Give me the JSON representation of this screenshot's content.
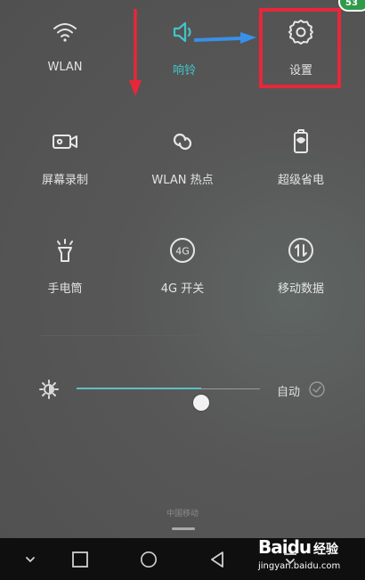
{
  "colors": {
    "accent": "#43c4c8",
    "highlight_box": "#e8263a",
    "arrow_red": "#e8263a",
    "arrow_blue": "#3a8fe8",
    "badge": "#2f9a4a"
  },
  "tiles": [
    {
      "label": "WLAN",
      "icon": "wifi-icon",
      "active": false
    },
    {
      "label": "响铃",
      "icon": "speaker-icon",
      "active": true
    },
    {
      "label": "设置",
      "icon": "gear-icon",
      "active": false
    },
    {
      "label": "屏幕录制",
      "icon": "screen-record-icon",
      "active": false
    },
    {
      "label": "WLAN 热点",
      "icon": "hotspot-icon",
      "active": false
    },
    {
      "label": "超级省电",
      "icon": "battery-saver-icon",
      "active": false
    },
    {
      "label": "手电筒",
      "icon": "flashlight-icon",
      "active": false
    },
    {
      "label": "4G 开关",
      "icon": "4g-icon",
      "active": false
    },
    {
      "label": "移动数据",
      "icon": "mobile-data-icon",
      "active": false
    }
  ],
  "icon_text": {
    "4g": "4G"
  },
  "brightness": {
    "level": 0.68,
    "auto_label": "自动",
    "auto_checked": false
  },
  "carrier": "中国移动",
  "navbar": {
    "icons": [
      "chevron-down-icon",
      "square-icon",
      "circle-icon",
      "triangle-back-icon",
      "pull-down-icon"
    ]
  },
  "badge": "53",
  "watermark": {
    "logo": "Baidu",
    "sub": "经验",
    "url": "jingyan.baidu.com"
  }
}
